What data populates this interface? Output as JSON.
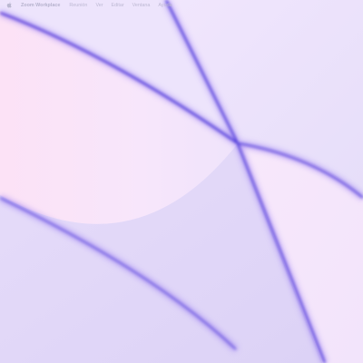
{
  "colors": {
    "wallpaper_base": "#e9e1fb",
    "wallpaper_pink": "#fbe3f7",
    "wallpaper_edge": "#5a3fe0",
    "menubar_text": "#bbb8d1"
  },
  "menubar": {
    "apple_icon": "apple-logo-icon",
    "app_name": "Zoom Workplace",
    "items": [
      {
        "label": "Reunión"
      },
      {
        "label": "Ver"
      },
      {
        "label": "Editar"
      },
      {
        "label": "Ventana"
      },
      {
        "label": "Ayuda"
      }
    ]
  }
}
